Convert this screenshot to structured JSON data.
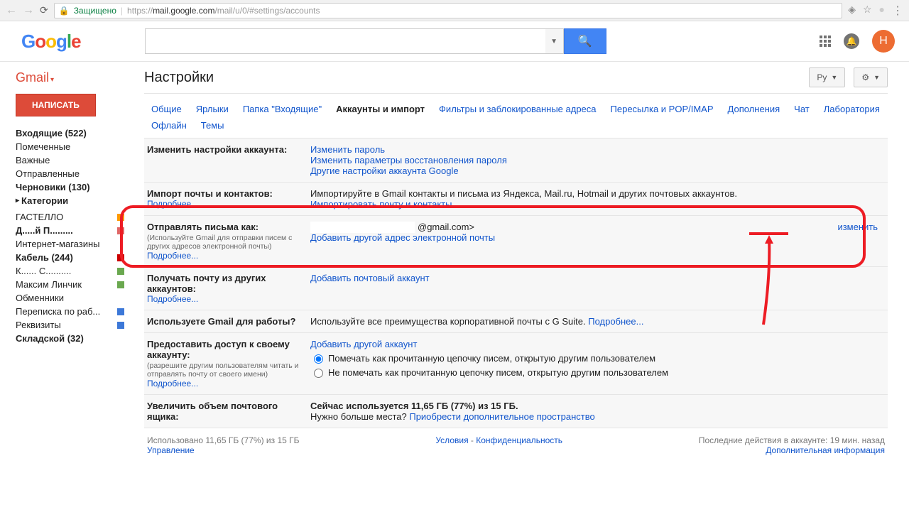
{
  "browser": {
    "secure_label": "Защищено",
    "url_host": "https://",
    "url_main": "mail.google.com",
    "url_path": "/mail/u/0/#settings/accounts"
  },
  "header": {
    "avatar_initial": "Н"
  },
  "sidebar": {
    "gmail": "Gmail",
    "compose": "НАПИСАТЬ",
    "nav": [
      {
        "label": "Входящие (522)",
        "bold": true
      },
      {
        "label": "Помеченные"
      },
      {
        "label": "Важные"
      },
      {
        "label": "Отправленные"
      },
      {
        "label": "Черновики (130)",
        "bold": true
      },
      {
        "label": "Категории",
        "bold": true,
        "cat": true
      }
    ],
    "labels": [
      {
        "label": "ГАСТЕЛЛО",
        "color": "#ff9900"
      },
      {
        "label": "Д.....й  П.........",
        "color": "#e06666",
        "bold": true
      },
      {
        "label": "Интернет-магазины"
      },
      {
        "label": "Кабель (244)",
        "color": "#cc0000",
        "bold": true
      },
      {
        "label": "К......  С..........",
        "color": "#6aa84f"
      },
      {
        "label": "Максим Линчик",
        "color": "#6aa84f"
      },
      {
        "label": "Обменники"
      },
      {
        "label": "Переписка по раб...",
        "color": "#3c78d8"
      },
      {
        "label": "Реквизиты",
        "color": "#3c78d8"
      },
      {
        "label": "Складской (32)",
        "bold": true
      }
    ]
  },
  "content": {
    "title": "Настройки",
    "lang_btn": "Ру",
    "tabs": [
      "Общие",
      "Ярлыки",
      "Папка \"Входящие\"",
      "Аккаунты и импорт",
      "Фильтры и заблокированные адреса",
      "Пересылка и POP/IMAP",
      "Дополнения",
      "Чат",
      "Лаборатория",
      "Офлайн",
      "Темы"
    ],
    "active_tab": 3,
    "rows": {
      "acct": {
        "title": "Изменить настройки аккаунта:",
        "links": [
          "Изменить пароль",
          "Изменить параметры восстановления пароля",
          "Другие настройки аккаунта Google"
        ]
      },
      "import": {
        "title": "Импорт почты и контактов:",
        "more": "Подробнее...",
        "text": "Импортируйте в Gmail контакты и письма из Яндекса, Mail.ru, Hotmail и других почтовых аккаунтов.",
        "link": "Импортировать почту и контакты"
      },
      "sendas": {
        "title": "Отправлять письма как:",
        "hint": "(Используйте Gmail для отправки писем с других адресов электронной почты)",
        "more": "Подробнее...",
        "email": "@gmail.com>",
        "add": "Добавить другой адрес электронной почты",
        "action": "изменить"
      },
      "getmail": {
        "title": "Получать почту из других аккаунтов:",
        "more": "Подробнее...",
        "link": "Добавить почтовый аккаунт"
      },
      "gsuite": {
        "title": "Используете Gmail для работы?",
        "text": "Используйте все преимущества корпоративной почты с G Suite.",
        "more": "Подробнее..."
      },
      "grant": {
        "title": "Предоставить доступ к своему аккаунту:",
        "hint": "(разрешите другим пользователям читать и отправлять почту от своего имени)",
        "more": "Подробнее...",
        "link": "Добавить другой аккаунт",
        "radio1": "Помечать как прочитанную цепочку писем, открытую другим пользователем",
        "radio2": "Не помечать как прочитанную цепочку писем, открытую другим пользователем"
      },
      "storage": {
        "title": "Увеличить объем почтового ящика:",
        "text1": "Сейчас используется 11,65 ГБ (77%) из 15 ГБ.",
        "text2": "Нужно больше места?",
        "link": "Приобрести дополнительное пространство"
      }
    },
    "footer": {
      "used": "Использовано 11,65 ГБ (77%) из 15 ГБ",
      "manage": "Управление",
      "terms": "Условия",
      "privacy": "Конфиденциальность",
      "activity": "Последние действия в аккаунте: 19 мин. назад",
      "details": "Дополнительная информация"
    }
  }
}
